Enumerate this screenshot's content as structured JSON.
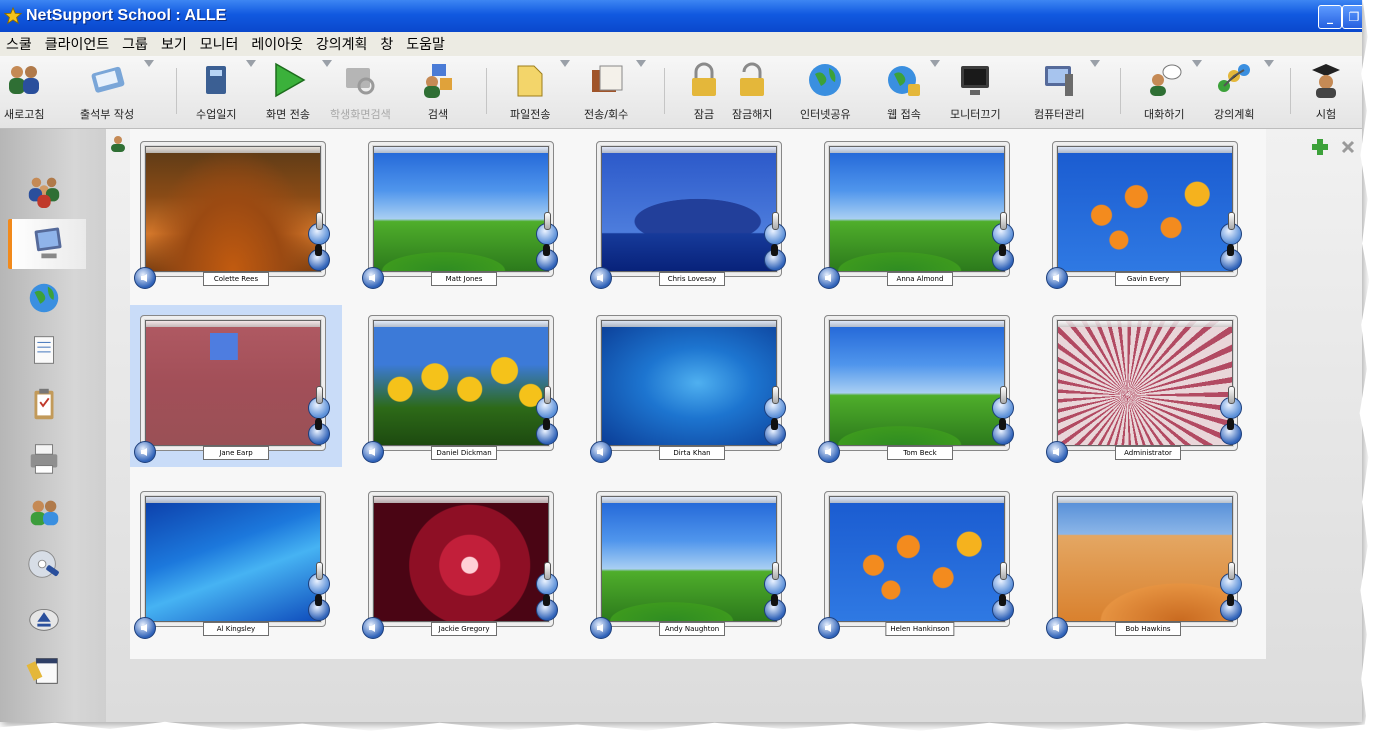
{
  "window": {
    "title": "NetSupport School : ALLE"
  },
  "menu": [
    "스쿨",
    "클라이언트",
    "그룹",
    "보기",
    "모니터",
    "레이아웃",
    "강의계획",
    "창",
    "도움말"
  ],
  "toolbar": [
    {
      "label": "새로고침",
      "icon": "refresh-users-icon"
    },
    {
      "label": "출석부 작성",
      "icon": "register-card-icon"
    },
    {
      "label": "수업일지",
      "icon": "lesson-journal-icon"
    },
    {
      "label": "화면 전송",
      "icon": "show-play-icon"
    },
    {
      "label": "학생화면검색",
      "icon": "student-screen-search-icon",
      "disabled": true
    },
    {
      "label": "검색",
      "icon": "search-users-icon"
    },
    {
      "label": "파일전송",
      "icon": "file-transfer-icon"
    },
    {
      "label": "전송/회수",
      "icon": "distribute-collect-icon"
    },
    {
      "label": "잠금",
      "icon": "lock-icon"
    },
    {
      "label": "잠금해지",
      "icon": "unlock-icon"
    },
    {
      "label": "인터넷공유",
      "icon": "internet-share-icon"
    },
    {
      "label": "웹 접속",
      "icon": "web-access-icon"
    },
    {
      "label": "모니터끄기",
      "icon": "monitor-off-icon"
    },
    {
      "label": "컴퓨터관리",
      "icon": "computer-management-icon"
    },
    {
      "label": "대화하기",
      "icon": "chat-icon"
    },
    {
      "label": "강의계획",
      "icon": "lesson-plan-icon"
    },
    {
      "label": "시험",
      "icon": "test-graduate-icon"
    }
  ],
  "sidebar": [
    {
      "name": "groups",
      "icon": "users-group-icon"
    },
    {
      "name": "monitor",
      "icon": "monitor-icon",
      "active": true
    },
    {
      "name": "web",
      "icon": "globe-icon"
    },
    {
      "name": "printer-doc",
      "icon": "document-icon"
    },
    {
      "name": "clipboard",
      "icon": "clipboard-icon"
    },
    {
      "name": "printer",
      "icon": "printer-icon"
    },
    {
      "name": "students",
      "icon": "student-users-icon"
    },
    {
      "name": "media",
      "icon": "cd-media-icon"
    },
    {
      "name": "eject",
      "icon": "eject-icon"
    },
    {
      "name": "notes",
      "icon": "notes-icon"
    }
  ],
  "students": [
    {
      "name": "Colette Rees",
      "wallpaper": "wp-autumn"
    },
    {
      "name": "Matt Jones",
      "wallpaper": "wp-bliss"
    },
    {
      "name": "Chris Lovesay",
      "wallpaper": "wp-mountain"
    },
    {
      "name": "Anna Almond",
      "wallpaper": "wp-bliss"
    },
    {
      "name": "Gavin Every",
      "wallpaper": "wp-fish"
    },
    {
      "name": "Jane Earp",
      "wallpaper": "wp-pinkwall",
      "selected": true
    },
    {
      "name": "Daniel Dickman",
      "wallpaper": "wp-tulips"
    },
    {
      "name": "Dirta Khan",
      "wallpaper": "wp-win7"
    },
    {
      "name": "Tom Beck",
      "wallpaper": "wp-bliss"
    },
    {
      "name": "Administrator",
      "wallpaper": "wp-feather"
    },
    {
      "name": "Al Kingsley",
      "wallpaper": "wp-bluewave"
    },
    {
      "name": "Jackie Gregory",
      "wallpaper": "wp-flower"
    },
    {
      "name": "Andy Naughton",
      "wallpaper": "wp-bliss"
    },
    {
      "name": "Helen Hankinson",
      "wallpaper": "wp-fish"
    },
    {
      "name": "Bob Hawkins",
      "wallpaper": "wp-desert"
    }
  ],
  "colors": {
    "titlebar": "#1159e0",
    "accent": "#f28a1c",
    "selected": "#c9dcf8"
  }
}
